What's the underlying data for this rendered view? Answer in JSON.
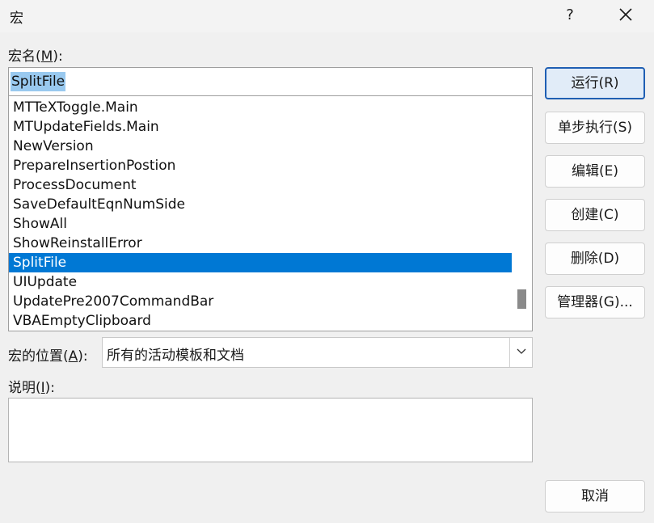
{
  "window": {
    "title": "宏",
    "help_label": "?"
  },
  "macro_name": {
    "label_prefix": "宏名(",
    "label_key": "M",
    "label_suffix": "):",
    "value": "SplitFile"
  },
  "macro_list": {
    "items": [
      "MTTeXToggle.Main",
      "MTUpdateFields.Main",
      "NewVersion",
      "PrepareInsertionPostion",
      "ProcessDocument",
      "SaveDefaultEqnNumSide",
      "ShowAll",
      "ShowReinstallError",
      "SplitFile",
      "UIUpdate",
      "UpdatePre2007CommandBar",
      "VBAEmptyClipboard"
    ],
    "selected_item": "SplitFile"
  },
  "location": {
    "label_prefix": "宏的位置(",
    "label_key": "A",
    "label_suffix": "):",
    "value": "所有的活动模板和文档"
  },
  "description": {
    "label_prefix": "说明(",
    "label_key": "I",
    "label_suffix": "):",
    "value": ""
  },
  "buttons": {
    "run": "运行(R)",
    "step_into": "单步执行(S)",
    "edit": "编辑(E)",
    "create": "创建(C)",
    "delete": "删除(D)",
    "organizer": "管理器(G)...",
    "cancel": "取消"
  },
  "colors": {
    "selection": "#0078d4",
    "text_selection": "#99c9ef",
    "default_button_border": "#1f5fb3"
  }
}
